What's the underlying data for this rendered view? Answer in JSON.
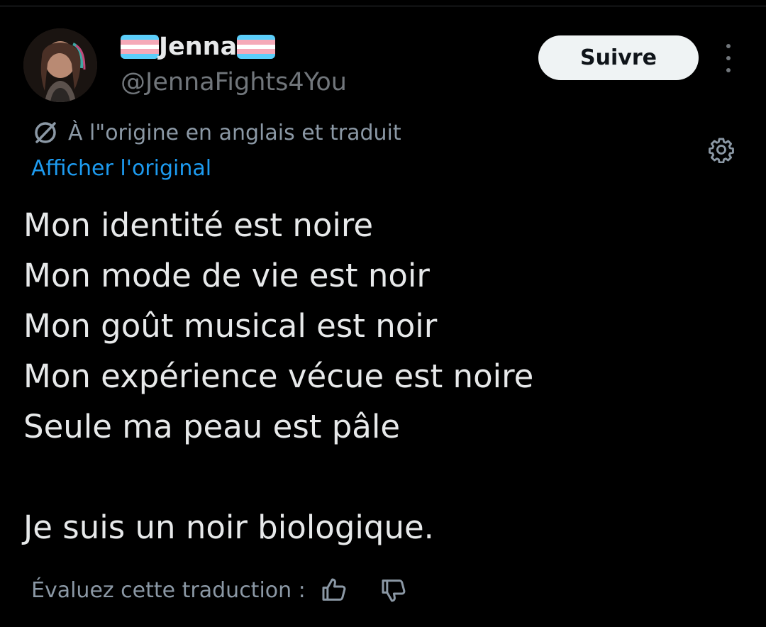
{
  "tweet": {
    "author": {
      "display_name": "Jenna",
      "handle": "@JennaFights4You",
      "name_prefix_icon": "transgender-flag",
      "name_suffix_icon": "transgender-flag"
    },
    "follow_label": "Suivre",
    "more_icon": "more-vertical-icon",
    "translation": {
      "notice": "À l\"origine en anglais et traduit",
      "notice_icon": "globe-icon",
      "show_original": "Afficher l'original",
      "settings_icon": "gear-icon"
    },
    "text": {
      "line1": "Mon identité est noire",
      "line2": "Mon mode de vie est noir",
      "line3": "Mon goût musical est noir",
      "line4": "Mon expérience vécue est noire",
      "line5": "Seule ma peau est pâle",
      "line6": "Je suis un noir biologique."
    },
    "rate_translation": {
      "label": "Évaluez cette traduction :",
      "like_icon": "thumbs-up-icon",
      "dislike_icon": "thumbs-down-icon"
    }
  },
  "colors": {
    "background": "#000000",
    "primary_text": "#e7e9ea",
    "secondary_text": "#71767b",
    "link": "#1d9bf0",
    "flag_blue": "#5bcefa",
    "flag_pink": "#f5a9b8",
    "flag_white": "#ffffff",
    "button_bg": "#eff3f4"
  }
}
